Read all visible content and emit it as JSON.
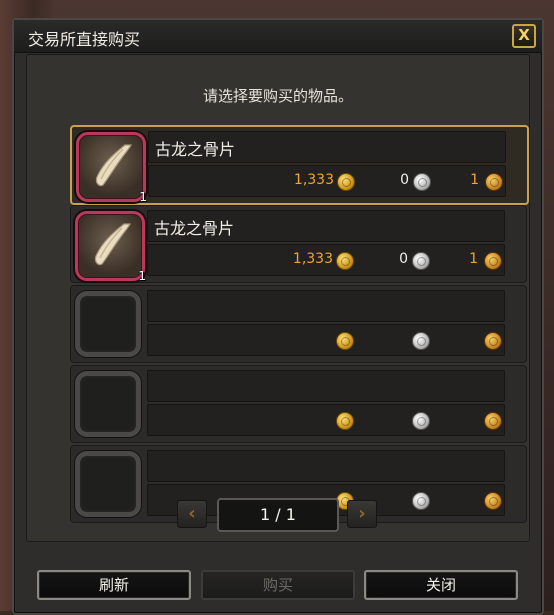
{
  "window": {
    "title": "交易所直接购买",
    "close_glyph": "X"
  },
  "prompt": "请选择要购买的物品。",
  "items": [
    {
      "name": "古龙之骨片",
      "count": "1",
      "gold": "1,333",
      "silver": "0",
      "bronze": "1",
      "selected": true,
      "icon": "bone-fragment-icon"
    },
    {
      "name": "古龙之骨片",
      "count": "1",
      "gold": "1,333",
      "silver": "0",
      "bronze": "1",
      "selected": false,
      "icon": "bone-fragment-icon"
    },
    {
      "name": "",
      "count": "",
      "gold": "",
      "silver": "",
      "bronze": ""
    },
    {
      "name": "",
      "count": "",
      "gold": "",
      "silver": "",
      "bronze": ""
    },
    {
      "name": "",
      "count": "",
      "gold": "",
      "silver": "",
      "bronze": ""
    }
  ],
  "pager": {
    "label": "1 / 1",
    "prev_glyph": "‹",
    "next_glyph": "›"
  },
  "buttons": {
    "refresh": "刷新",
    "buy": "购买",
    "close": "关闭"
  },
  "colors": {
    "selected_border": "#c9a24f",
    "price_gold": "#f1a62a",
    "slot_frame": "#b83a5a"
  }
}
